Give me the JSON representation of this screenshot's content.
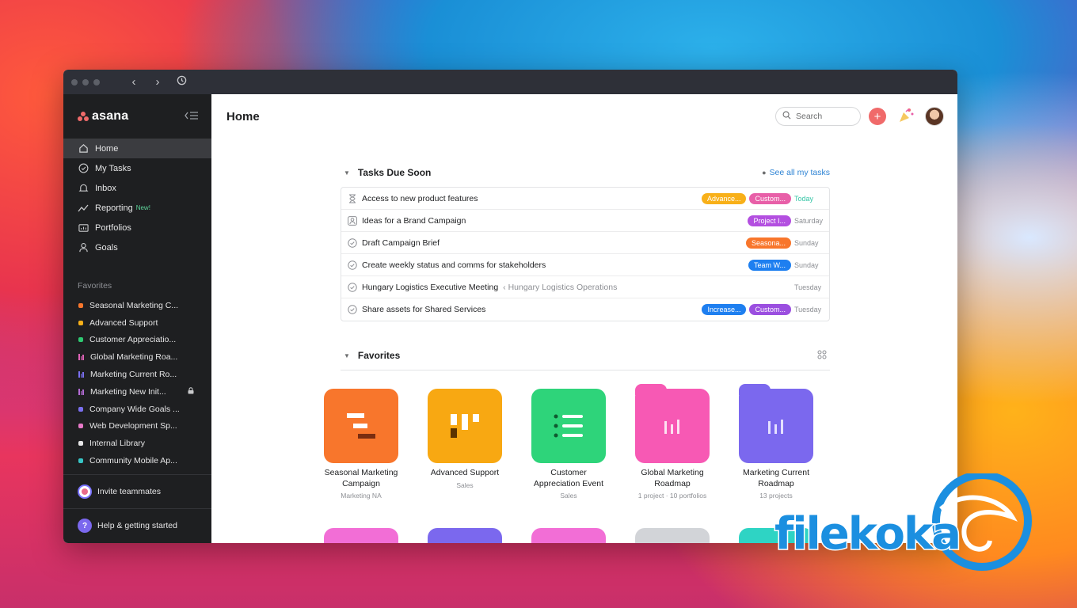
{
  "titlebar": {
    "back_icon": "chevron-left-icon",
    "forward_icon": "chevron-right-icon",
    "history_icon": "clock-icon"
  },
  "sidebar": {
    "logo_text": "asana",
    "nav": [
      {
        "label": "Home",
        "icon": "home-icon",
        "active": true
      },
      {
        "label": "My Tasks",
        "icon": "check-circle-icon"
      },
      {
        "label": "Inbox",
        "icon": "bell-icon"
      },
      {
        "label": "Reporting",
        "icon": "trend-line-icon",
        "badge": "New!"
      },
      {
        "label": "Portfolios",
        "icon": "portfolio-icon"
      },
      {
        "label": "Goals",
        "icon": "person-icon"
      }
    ],
    "favorites_title": "Favorites",
    "favorites": [
      {
        "label": "Seasonal Marketing C...",
        "color": "#f8762c",
        "kind": "dot"
      },
      {
        "label": "Advanced Support",
        "color": "#f8b019",
        "kind": "dot"
      },
      {
        "label": "Customer Appreciatio...",
        "color": "#2ec971",
        "kind": "dot"
      },
      {
        "label": "Global Marketing Roa...",
        "color": "#e063b8",
        "kind": "bars"
      },
      {
        "label": "Marketing Current Ro...",
        "color": "#7a6ff0",
        "kind": "bars"
      },
      {
        "label": "Marketing New Init...",
        "color": "#b36bd4",
        "kind": "bars",
        "locked": true
      },
      {
        "label": "Company Wide Goals ...",
        "color": "#7a6ff0",
        "kind": "dot"
      },
      {
        "label": "Web Development Sp...",
        "color": "#e879c9",
        "kind": "dot"
      },
      {
        "label": "Internal Library",
        "color": "#e6e6e7",
        "kind": "dot"
      },
      {
        "label": "Community Mobile Ap...",
        "color": "#37c5c6",
        "kind": "dot"
      }
    ],
    "invite_label": "Invite teammates",
    "help_label": "Help & getting started",
    "help_glyph": "?"
  },
  "header": {
    "title": "Home",
    "search_placeholder": "Search"
  },
  "tasks": {
    "title": "Tasks Due Soon",
    "see_all": "See all my tasks",
    "rows": [
      {
        "name": "Access to new product features",
        "icon": "hourglass-icon",
        "tags": [
          {
            "label": "Advance...",
            "color": "#f8b019"
          },
          {
            "label": "Custom...",
            "color": "#e85fa8"
          }
        ],
        "due": "Today",
        "today": true
      },
      {
        "name": "Ideas for a Brand Campaign",
        "icon": "approval-icon",
        "tags": [
          {
            "label": "Project I...",
            "color": "#b34fe0"
          }
        ],
        "due": "Saturday"
      },
      {
        "name": "Draft Campaign Brief",
        "icon": "check-circle-icon",
        "tags": [
          {
            "label": "Seasona...",
            "color": "#f8762c"
          }
        ],
        "due": "Sunday"
      },
      {
        "name": "Create weekly status and comms for stakeholders",
        "icon": "check-circle-icon",
        "tags": [
          {
            "label": "Team W...",
            "color": "#1e7ff0"
          }
        ],
        "due": "Sunday"
      },
      {
        "name": "Hungary Logistics Executive Meeting",
        "sub": "‹ Hungary Logistics Operations",
        "icon": "check-circle-icon",
        "tags": [],
        "due": "Tuesday"
      },
      {
        "name": "Share assets for Shared Services",
        "icon": "check-circle-icon",
        "tags": [
          {
            "label": "Increase...",
            "color": "#1e7ff0"
          },
          {
            "label": "Custom...",
            "color": "#9b4fe0"
          }
        ],
        "due": "Tuesday"
      }
    ]
  },
  "favorites": {
    "title": "Favorites",
    "tiles": [
      {
        "name": "Seasonal Marketing Campaign",
        "sub": "Marketing NA",
        "color": "#f8762c",
        "icon": "timeline-icon",
        "folder": false
      },
      {
        "name": "Advanced Support",
        "sub": "Sales",
        "color": "#f8a812",
        "icon": "board-icon",
        "folder": false
      },
      {
        "name": "Customer Appreciation Event",
        "sub": "Sales",
        "color": "#2ed47a",
        "icon": "list-icon",
        "folder": false
      },
      {
        "name": "Global Marketing Roadmap",
        "sub": "1 project · 10 portfolios",
        "color": "#f759b4",
        "icon": "bar-chart-icon",
        "folder": true
      },
      {
        "name": "Marketing Current Roadmap",
        "sub": "13 projects",
        "color": "#7b68ee",
        "icon": "bar-chart-icon",
        "folder": true
      }
    ],
    "row2_colors": [
      "#f26ed6",
      "#7b68ee",
      "#f26ed6",
      "#d2d4d8",
      "#2ed4c4"
    ]
  },
  "watermark": {
    "text": "filekoka"
  }
}
